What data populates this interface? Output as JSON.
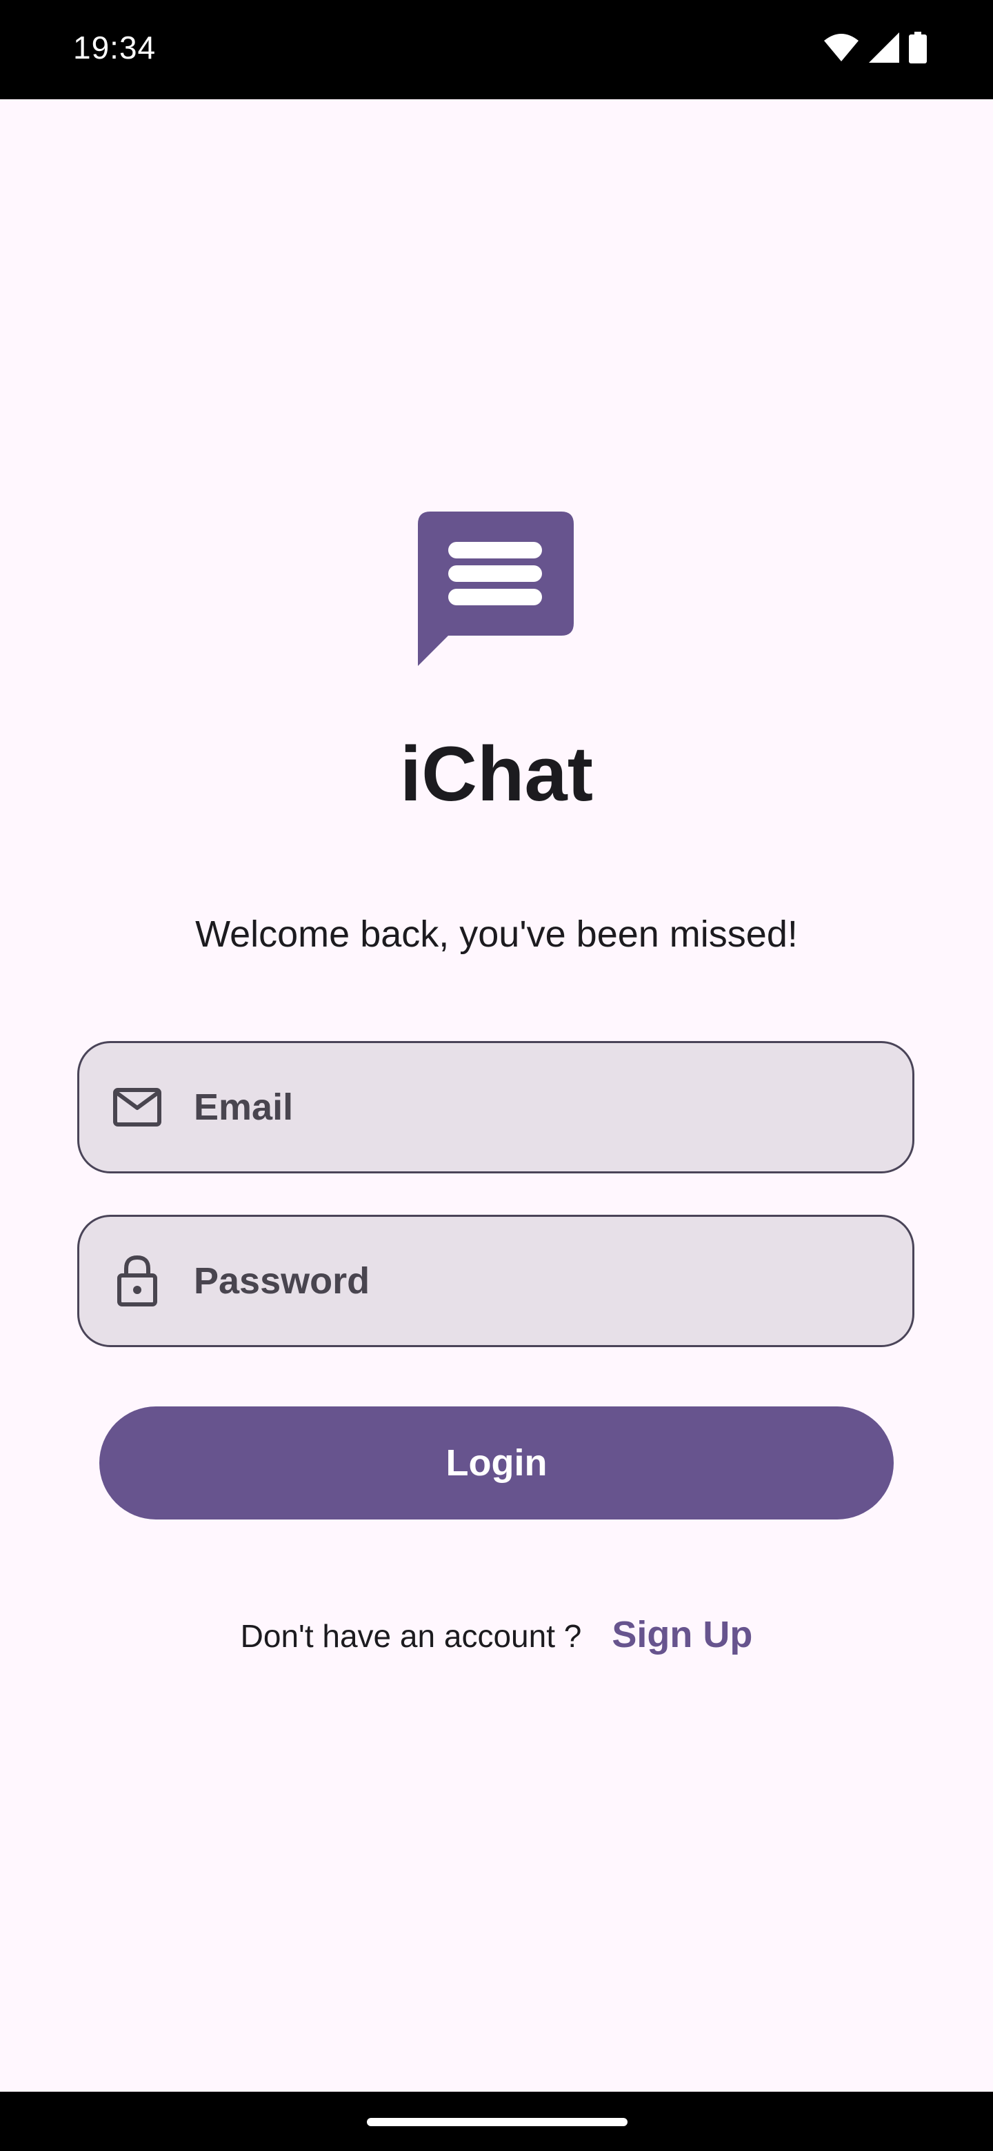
{
  "status_bar": {
    "time": "19:34",
    "icons": [
      "wifi-icon",
      "cellular-signal-icon",
      "battery-icon"
    ]
  },
  "app": {
    "logo_icon": "chat-bubble-icon",
    "title": "iChat",
    "welcome": "Welcome back, you've been missed!",
    "brand_color": "#67548e"
  },
  "form": {
    "email": {
      "icon": "mail-icon",
      "placeholder": "Email",
      "value": ""
    },
    "password": {
      "icon": "lock-icon",
      "placeholder": "Password",
      "value": ""
    },
    "login_label": "Login"
  },
  "signup": {
    "prompt": "Don't have an account ?",
    "link_label": "Sign Up"
  }
}
